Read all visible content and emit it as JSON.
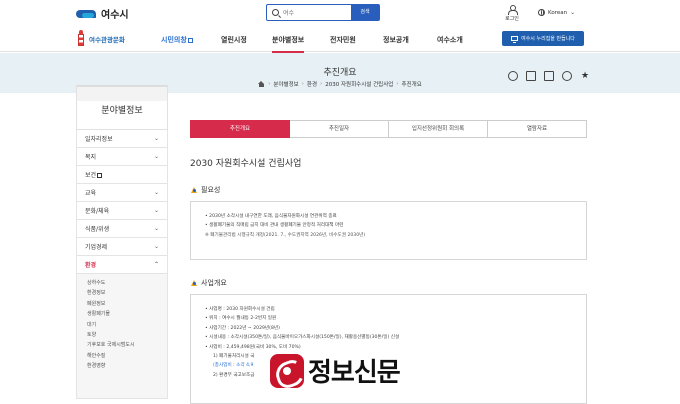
{
  "header": {
    "logo_text": "여수시",
    "search_placeholder": "여수",
    "search_button": "검색",
    "login_label": "로그인",
    "language": "Korean"
  },
  "nav": {
    "tour_label": "여수관광문화",
    "items": [
      "시민의창",
      "열린시정",
      "분야별정보",
      "전자민원",
      "정보공개",
      "여수소개"
    ],
    "active_index": 2,
    "mayor_button": "여수시 누리집을 만듭니다"
  },
  "banner": {
    "title": "추진개요",
    "breadcrumb": [
      "분야별정보",
      "환경",
      "2030 자원회수시설 건립사업",
      "추진개요"
    ]
  },
  "sidebar": {
    "title": "분야별정보",
    "items": [
      {
        "label": "일자리정보"
      },
      {
        "label": "복지"
      },
      {
        "label": "보건"
      },
      {
        "label": "교육"
      },
      {
        "label": "문화/체육"
      },
      {
        "label": "식품/위생"
      },
      {
        "label": "기업경제"
      },
      {
        "label": "환경"
      }
    ],
    "active_index": 7,
    "sub_items": [
      "상하수도",
      "환경정보",
      "폐원정보",
      "생활폐기물",
      "대기",
      "토양",
      "기후보호 국제시범도시",
      "해안수질",
      "환경영향"
    ]
  },
  "tabs": [
    "추진개요",
    "추진일자",
    "입지선정위원회 회의록",
    "열람자료"
  ],
  "active_tab": 0,
  "content": {
    "title": "2030 자원회수시설 건립사업",
    "section1": {
      "heading": "필요성",
      "lines": [
        "• 2030년 소각시설 내구연한 도래, 음식물자원화시설 연관위역 종료",
        "• 생활폐기물의 직매립 금지 대비 관내 생활폐기물 안정적 처리대책 마련",
        "※ 폐기물관리법 시행규칙 개정(2021. 7., 수도권지역 2026년, 비수도권 2030년)"
      ]
    },
    "section2": {
      "heading": "사업개요",
      "lines": [
        "• 사업명 : 2030 자원회수시설 건립",
        "• 위치 : 여수시 월내동 2-2번지 일원",
        "• 사업기간 : 2022년 ~ 2029년(8년)",
        "• 시설내용 : 소각시설(350톤/일), 음식물바이오가스화시설(150톤/일), 재활용선별동(30톤/일) 신설",
        "• 사업비 : 2,459,498원(국비 30%, 도비 70%)",
        "1) 폐기물처리시설 국",
        "(총사업비 : 소각 4,9",
        "2) 환경부 국고보조금"
      ]
    }
  },
  "watermark": {
    "text": "정보신문"
  }
}
